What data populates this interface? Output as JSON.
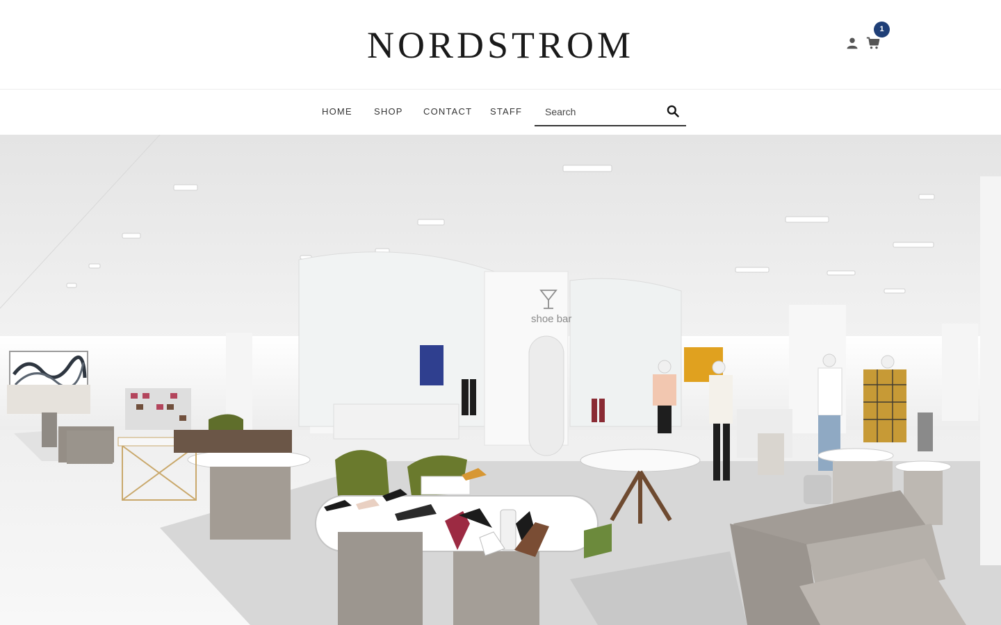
{
  "header": {
    "brand": "NORDSTROM",
    "account_icon": "user-icon",
    "cart_icon": "shopping-cart-icon",
    "cart_count": "1",
    "accent_color": "#1f3f77"
  },
  "nav": {
    "items": [
      {
        "label": "HOME"
      },
      {
        "label": "SHOP"
      },
      {
        "label": "CONTACT"
      },
      {
        "label": "STAFF"
      }
    ],
    "search": {
      "placeholder": "Search",
      "icon": "search-icon"
    }
  },
  "hero": {
    "description_alt": "Nordstrom shoe department store interior",
    "sign_text": "shoe bar"
  }
}
